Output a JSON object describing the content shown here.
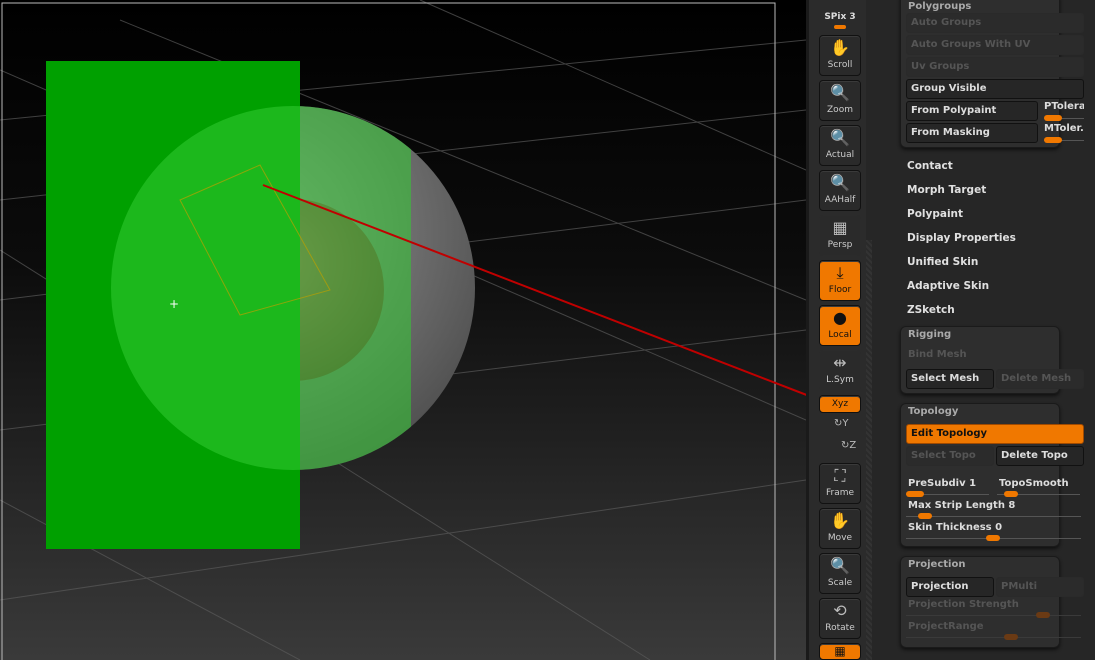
{
  "toolbar": {
    "spix": "SPix 3",
    "buttons": [
      {
        "label": "Scroll",
        "icon": "hand-icon"
      },
      {
        "label": "Zoom",
        "icon": "magnifier-icon"
      },
      {
        "label": "Actual",
        "icon": "magnifier-x1-icon"
      },
      {
        "label": "AAHalf",
        "icon": "magnifier-half-icon"
      },
      {
        "label": "Persp",
        "icon": "grid-perspective-icon"
      },
      {
        "label": "Floor",
        "icon": "floor-icon",
        "active": true
      },
      {
        "label": "Local",
        "icon": "local-icon",
        "active": true
      },
      {
        "label": "L.Sym",
        "icon": "symmetry-icon"
      },
      {
        "label": "Xyz",
        "icon": "rotate-xyz-icon",
        "active": true
      },
      {
        "label": "Frame",
        "icon": "frame-icon"
      },
      {
        "label": "Move",
        "icon": "move-icon"
      },
      {
        "label": "Scale",
        "icon": "scale-icon"
      },
      {
        "label": "Rotate",
        "icon": "rotate-icon"
      }
    ],
    "rot_y": "Y",
    "rot_z": "Z"
  },
  "panel": {
    "polygroups": {
      "title": "Polygroups",
      "auto_groups": "Auto Groups",
      "auto_groups_uv": "Auto Groups With UV",
      "uv_groups": "Uv Groups",
      "group_visible": "Group Visible",
      "from_polypaint": "From Polypaint",
      "ptolerance": "PTolera",
      "from_masking": "From Masking",
      "mtolerance": "MToler.",
      "ptolerance_value": 0.2,
      "mtolerance_value": 0.15
    },
    "sections": [
      "Contact",
      "Morph Target",
      "Polypaint",
      "Display Properties",
      "Unified Skin",
      "Adaptive Skin",
      "ZSketch"
    ],
    "rigging": {
      "title": "Rigging",
      "bind_mesh": "Bind Mesh",
      "select_mesh": "Select Mesh",
      "delete_mesh": "Delete Mesh"
    },
    "topology": {
      "title": "Topology",
      "edit_topology": "Edit Topology",
      "select_topo": "Select Topo",
      "delete_topo": "Delete Topo",
      "presubdiv": "PreSubdiv 1",
      "toposmooth": "TopoSmooth",
      "max_strip": "Max Strip Length 8",
      "skin_thickness": "Skin Thickness 0"
    },
    "projection": {
      "title": "Projection",
      "projection": "Projection",
      "pmulti": "PMulti",
      "strength": "Projection Strength",
      "range": "ProjectRange"
    }
  },
  "colors": {
    "accent": "#f07800",
    "selection": "#00a000",
    "arrow": "#c00000"
  }
}
